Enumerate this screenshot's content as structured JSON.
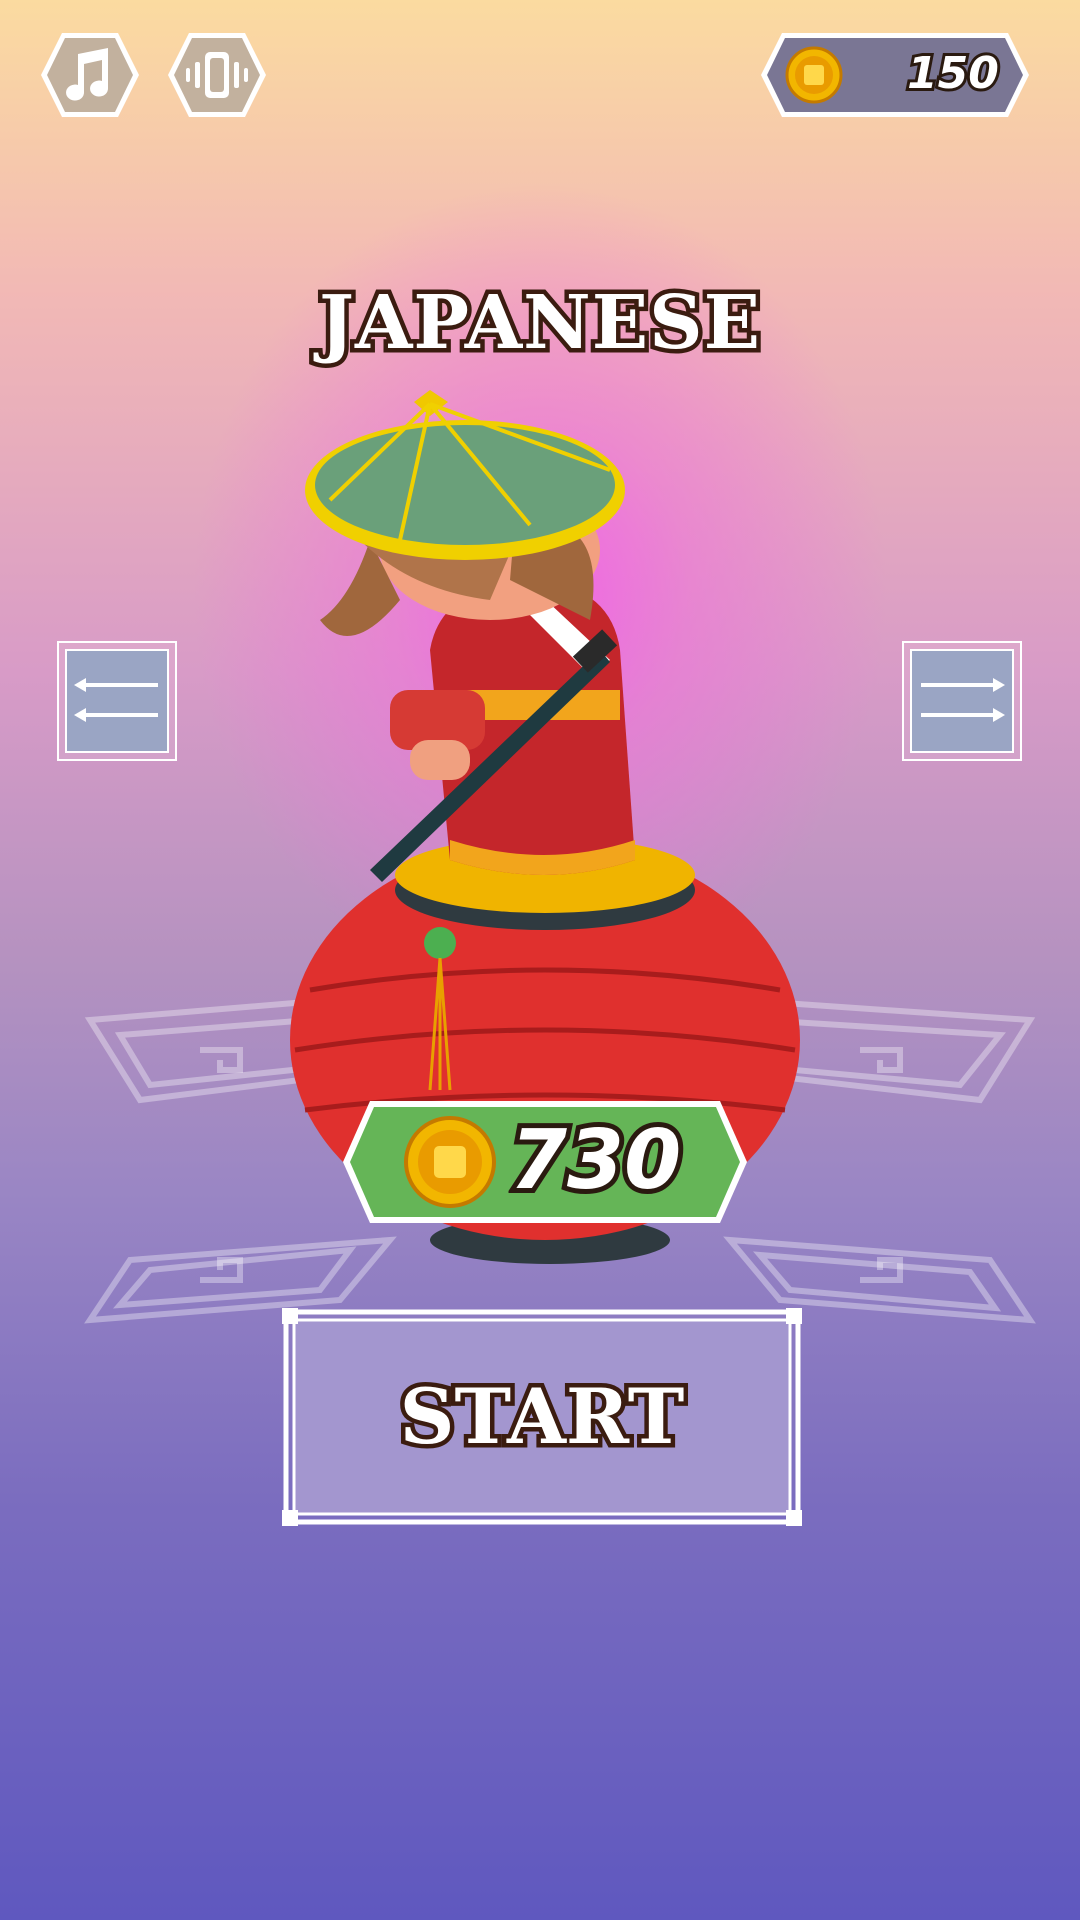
{
  "top_bar": {
    "music_button_icon": "music-note-icon",
    "vibration_button_icon": "vibration-icon",
    "coin_icon": "coin-icon",
    "coin_balance": "150"
  },
  "character": {
    "name": "JAPANESE",
    "price": "730",
    "price_icon": "coin-icon"
  },
  "navigation": {
    "prev_icon": "arrow-left-icon",
    "next_icon": "arrow-right-icon"
  },
  "start_button": {
    "label": "START"
  },
  "colors": {
    "bg_top": "#fbdba0",
    "bg_mid": "#b592c0",
    "bg_bottom": "#5f58bf",
    "glow": "#f45aeb",
    "hex_button_fill": "#c2b19e",
    "coin_counter_fill": "#7a7694",
    "price_badge_fill": "#4aa83a",
    "start_button_fill": "#a396cf",
    "coin_gold": "#f2b600"
  }
}
